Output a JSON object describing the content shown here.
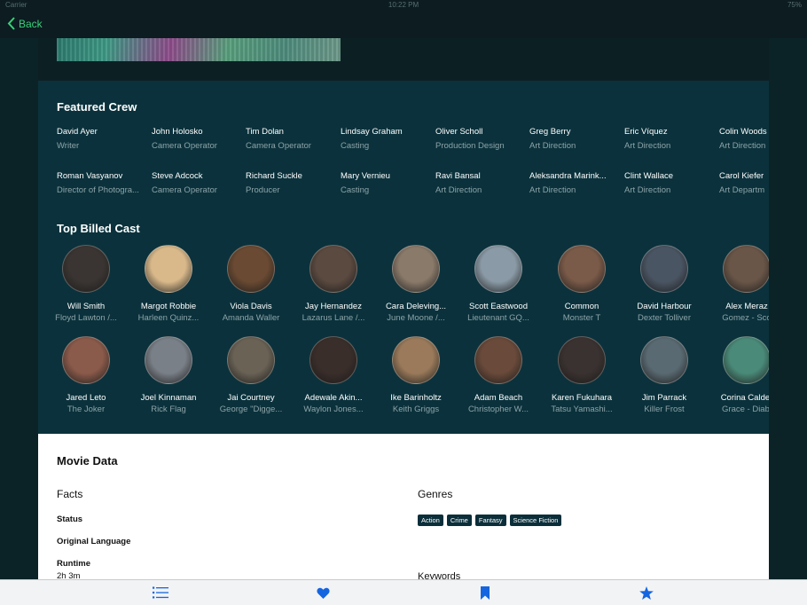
{
  "status_bar": {
    "carrier": "Carrier",
    "time": "10:22 PM",
    "battery": "75%"
  },
  "nav": {
    "back_label": "Back"
  },
  "featured_crew": {
    "title": "Featured Crew",
    "items": [
      {
        "name": "David Ayer",
        "job": "Writer"
      },
      {
        "name": "John Holosko",
        "job": "Camera Operator"
      },
      {
        "name": "Tim Dolan",
        "job": "Camera Operator"
      },
      {
        "name": "Lindsay Graham",
        "job": "Casting"
      },
      {
        "name": "Oliver Scholl",
        "job": "Production Design"
      },
      {
        "name": "Greg Berry",
        "job": "Art Direction"
      },
      {
        "name": "Eric Víquez",
        "job": "Art Direction"
      },
      {
        "name": "Colin Woods",
        "job": "Art Direction"
      },
      {
        "name": "Roman Vasyanov",
        "job": "Director of Photogra..."
      },
      {
        "name": "Steve Adcock",
        "job": "Camera Operator"
      },
      {
        "name": "Richard Suckle",
        "job": "Producer"
      },
      {
        "name": "Mary Vernieu",
        "job": "Casting"
      },
      {
        "name": "Ravi Bansal",
        "job": "Art Direction"
      },
      {
        "name": "Aleksandra Marink...",
        "job": "Art Direction"
      },
      {
        "name": "Clint Wallace",
        "job": "Art Direction"
      },
      {
        "name": "Carol Kiefer",
        "job": "Art Departm"
      }
    ]
  },
  "top_billed_cast": {
    "title": "Top Billed Cast",
    "items": [
      {
        "name": "Will Smith",
        "character": "Floyd Lawton /...",
        "color": "#3a3532"
      },
      {
        "name": "Margot Robbie",
        "character": "Harleen Quinz...",
        "color": "#d9b98a"
      },
      {
        "name": "Viola Davis",
        "character": "Amanda Waller",
        "color": "#6a4a32"
      },
      {
        "name": "Jay Hernandez",
        "character": "Lazarus Lane /...",
        "color": "#5b4a40"
      },
      {
        "name": "Cara Deleving...",
        "character": "June Moone /...",
        "color": "#8a7a6a"
      },
      {
        "name": "Scott Eastwood",
        "character": "Lieutenant GQ...",
        "color": "#8a9aa6"
      },
      {
        "name": "Common",
        "character": "Monster T",
        "color": "#7a5a48"
      },
      {
        "name": "David Harbour",
        "character": "Dexter Tolliver",
        "color": "#4a5563"
      },
      {
        "name": "Alex Meraz",
        "character": "Gomez - Sco",
        "color": "#6a5648"
      },
      {
        "name": "Jared Leto",
        "character": "The Joker",
        "color": "#8a5a4a"
      },
      {
        "name": "Joel Kinnaman",
        "character": "Rick Flag",
        "color": "#7a8088"
      },
      {
        "name": "Jai Courtney",
        "character": "George \"Digge...",
        "color": "#6a6255"
      },
      {
        "name": "Adewale Akin...",
        "character": "Waylon Jones...",
        "color": "#3a2e2a"
      },
      {
        "name": "Ike Barinholtz",
        "character": "Keith Griggs",
        "color": "#9a7a5a"
      },
      {
        "name": "Adam Beach",
        "character": "Christopher W...",
        "color": "#6a4a3a"
      },
      {
        "name": "Karen Fukuhara",
        "character": "Tatsu Yamashi...",
        "color": "#3a3230"
      },
      {
        "name": "Jim Parrack",
        "character": "Killer Frost",
        "color": "#5a6a72"
      },
      {
        "name": "Corina Calder",
        "character": "Grace - Diabl",
        "color": "#4a8a78"
      }
    ]
  },
  "movie_data": {
    "title": "Movie Data",
    "facts_heading": "Facts",
    "genres_heading": "Genres",
    "keywords_heading": "Keywords",
    "facts": [
      {
        "label": "Status",
        "value": ""
      },
      {
        "label": "Original Language",
        "value": ""
      },
      {
        "label": "Runtime",
        "value": "2h 3m"
      }
    ],
    "genres": [
      "Action",
      "Crime",
      "Fantasy",
      "Science Fiction"
    ]
  },
  "tab_bar": {
    "tabs": [
      {
        "icon": "list-icon",
        "color": "#1565e0"
      },
      {
        "icon": "heart-icon",
        "color": "#1565e0"
      },
      {
        "icon": "bookmark-icon",
        "color": "#1565e0"
      },
      {
        "icon": "star-icon",
        "color": "#1565e0"
      }
    ]
  },
  "colors": {
    "accent_green": "#3ad07a",
    "tab_blue": "#1565e0",
    "credits_bg": "#0b323c"
  }
}
